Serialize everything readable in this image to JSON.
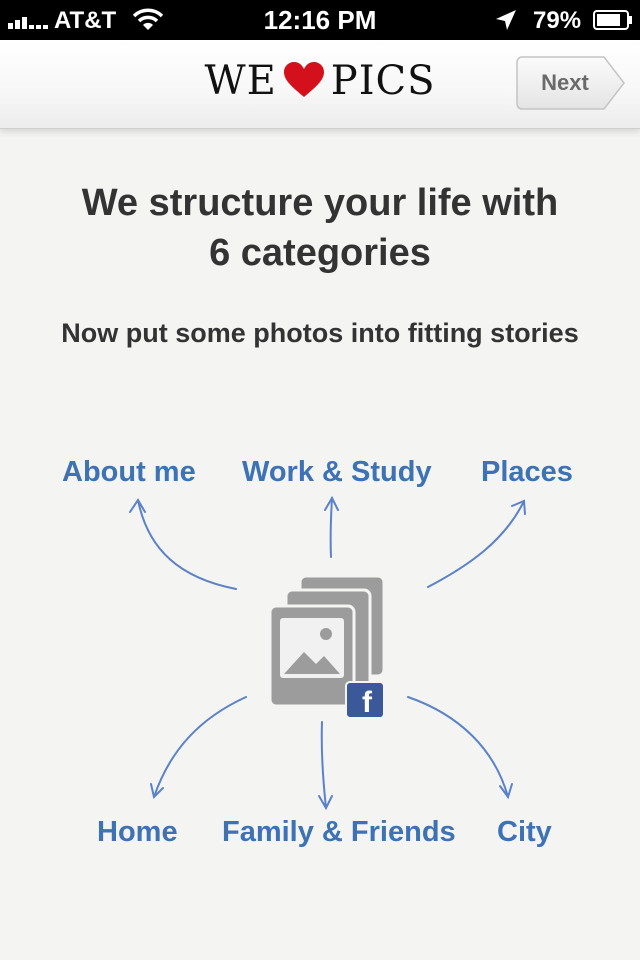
{
  "status_bar": {
    "carrier": "AT&T",
    "time": "12:16 PM",
    "battery": "79%",
    "icons": [
      "signal-icon",
      "wifi-icon",
      "location-arrow-icon",
      "battery-icon"
    ]
  },
  "nav": {
    "logo": {
      "left": "WE",
      "right": "PICS",
      "symbol": "heart-icon"
    },
    "next_label": "Next"
  },
  "content": {
    "headline_line1": "We structure your life with",
    "headline_line2": "6 categories",
    "subline": "Now put some photos into fitting stories",
    "categories": {
      "top": [
        "About me",
        "Work & Study",
        "Places"
      ],
      "bottom": [
        "Home",
        "Family & Friends",
        "City"
      ]
    },
    "center_icon": "photo-stack-facebook-icon"
  },
  "colors": {
    "category_text": "#3d72b4",
    "arrow": "#5b82c8",
    "heart": "#d3101c",
    "facebook": "#3b5998"
  }
}
